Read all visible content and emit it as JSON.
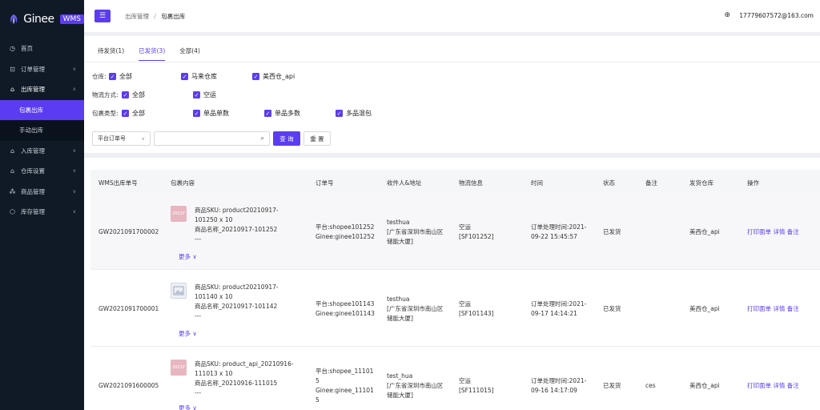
{
  "sidebar": {
    "logo_text": "Ginee",
    "logo_badge": "WMS",
    "items": [
      {
        "label": "首页",
        "icon": "dashboard-icon"
      },
      {
        "label": "订单管理",
        "icon": "cart-icon"
      },
      {
        "label": "出库管理",
        "icon": "outbound-icon"
      },
      {
        "label": "包裹出库"
      },
      {
        "label": "手动出库"
      },
      {
        "label": "入库管理",
        "icon": "inbound-icon"
      },
      {
        "label": "仓库设置",
        "icon": "warehouse-icon"
      },
      {
        "label": "商品管理",
        "icon": "product-icon"
      },
      {
        "label": "库存管理",
        "icon": "inventory-icon"
      }
    ]
  },
  "header": {
    "breadcrumb_parent": "出库管理",
    "breadcrumb_current": "包裹出库",
    "user_email": "17779607572@163.com"
  },
  "tabs": [
    "待发货(1)",
    "已发货(3)",
    "全部(4)"
  ],
  "filters": {
    "warehouse_label": "仓库:",
    "warehouse_options": [
      "全部",
      "马来仓库",
      "美西仓_api"
    ],
    "logistics_label": "物流方式:",
    "logistics_options": [
      "全部",
      "空运"
    ],
    "package_label": "包裹类型:",
    "package_options": [
      "全部",
      "单品单数",
      "单品多数",
      "多品混包"
    ]
  },
  "search": {
    "select_value": "平台订单号",
    "input_value": "",
    "query_label": "查 询",
    "reset_label": "重 置"
  },
  "table": {
    "columns": [
      "WMS出库单号",
      "包裹内容",
      "订单号",
      "收件人&地址",
      "物流信息",
      "时间",
      "状态",
      "备注",
      "发货仓库",
      "操作"
    ],
    "more_label": "更多",
    "actions": [
      "打印面单",
      "详情",
      "备注"
    ],
    "rows": [
      {
        "wms_no": "GW2021091700002",
        "thumb_text": "2021P",
        "sku_1": "商品SKU: product20210917-",
        "sku_2": "101250 x 10",
        "name": "商品名称_20210917-101252",
        "dash": "---",
        "order_1": "平台:shopee101252",
        "order_2": "Ginee:ginee101252",
        "order_3": "",
        "recv_1": "testhua",
        "recv_2": "[广东省深圳市南山区",
        "recv_3": "储能大厦]",
        "log_1": "空运",
        "log_2": "[SF101252]",
        "time_1": "订单处理时间:2021-",
        "time_2": "09-22 15:45:57",
        "status": "已发货",
        "note": "",
        "warehouse": "美西仓_api"
      },
      {
        "wms_no": "GW2021091700001",
        "thumb_text": "",
        "sku_1": "商品SKU: product20210917-",
        "sku_2": "101140 x 10",
        "name": "商品名称_20210917-101142",
        "dash": "---",
        "order_1": "平台:shopee101143",
        "order_2": "Ginee:ginee101143",
        "order_3": "",
        "recv_1": "testhua",
        "recv_2": "[广东省深圳市南山区",
        "recv_3": "储能大厦]",
        "log_1": "空运",
        "log_2": "[SF101143]",
        "time_1": "订单处理时间:2021-",
        "time_2": "09-17 14:14:21",
        "status": "已发货",
        "note": "",
        "warehouse": "美西仓_api"
      },
      {
        "wms_no": "GW2021091600005",
        "thumb_text": "2021P",
        "sku_1": "商品SKU: product_api_20210916-",
        "sku_2": "111013 x 10",
        "name": "商品名称_20210916-111015",
        "dash": "---",
        "order_1": "平台:shopee_11101",
        "order_2": "5",
        "order_3": "Ginee:ginee_11101",
        "order_4": "5",
        "recv_1": "test_hua",
        "recv_2": "[广东省深圳市南山区",
        "recv_3": "储能大厦]",
        "log_1": "空运",
        "log_2": "[SF111015]",
        "time_1": "订单处理时间:2021-",
        "time_2": "09-16 14:17:09",
        "status": "已发货",
        "note": "ces",
        "warehouse": "美西仓_api"
      }
    ]
  },
  "colors": {
    "accent": "#5c3cf0",
    "sidebar_bg": "#0f1a26"
  }
}
